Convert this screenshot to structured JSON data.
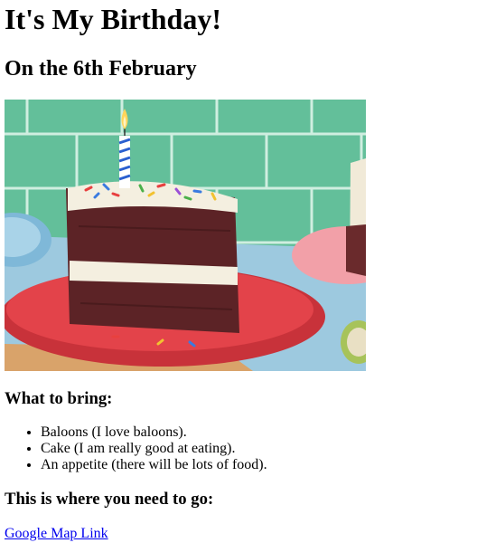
{
  "page": {
    "title": "It's My Birthday!",
    "date_heading": "On the 6th February",
    "bring_heading": "What to bring:",
    "bring_items": [
      "Baloons (I love baloons).",
      "Cake (I am really good at eating).",
      "An appetite (there will be lots of food)."
    ],
    "location_heading": "This is where you need to go:",
    "map_link_text": "Google Map Link"
  },
  "colors": {
    "tile_wall": "#63bf9a",
    "plate": "#e3434a",
    "cake": "#5c2326",
    "frosting": "#f4efe0",
    "table": "#9dc9df",
    "link": "#0000ee"
  },
  "image": {
    "subject": "slice of chocolate layer cake with white frosting, sprinkles and a lit striped candle on a red plate"
  }
}
